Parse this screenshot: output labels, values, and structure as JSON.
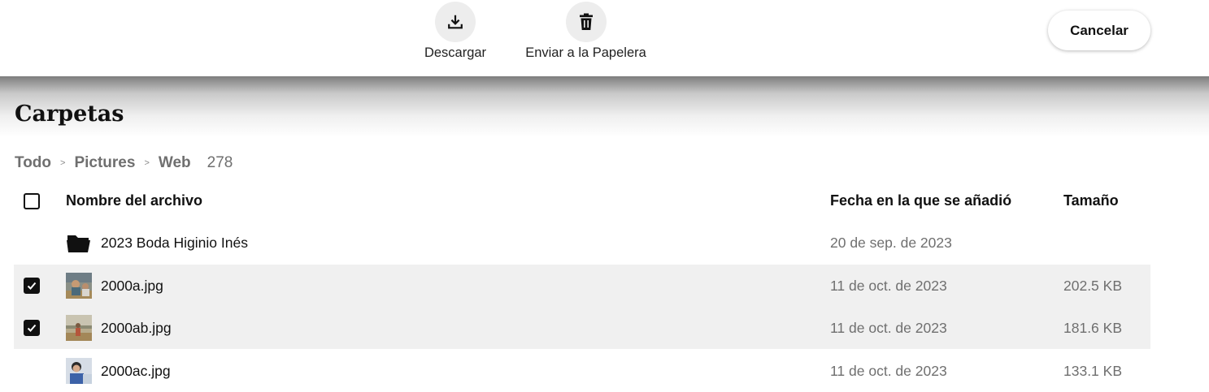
{
  "toolbar": {
    "actions": [
      {
        "label": "Descargar",
        "icon": "download-icon"
      },
      {
        "label": "Enviar a la Papelera",
        "icon": "trash-icon"
      }
    ],
    "cancel_label": "Cancelar"
  },
  "page": {
    "title": "Carpetas",
    "breadcrumb": [
      "Todo",
      "Pictures",
      "Web"
    ],
    "item_count": "278"
  },
  "table": {
    "columns": {
      "name": "Nombre del archivo",
      "date": "Fecha en la que se añadió",
      "size": "Tamaño"
    },
    "rows": [
      {
        "type": "folder",
        "name": "2023 Boda Higinio Inés",
        "date": "20 de sep. de 2023",
        "size": "",
        "selected": false
      },
      {
        "type": "image",
        "name": "2000a.jpg",
        "date": "11 de oct. de 2023",
        "size": "202.5 KB",
        "selected": true
      },
      {
        "type": "image",
        "name": "2000ab.jpg",
        "date": "11 de oct. de 2023",
        "size": "181.6 KB",
        "selected": true
      },
      {
        "type": "image",
        "name": "2000ac.jpg",
        "date": "11 de oct. de 2023",
        "size": "133.1 KB",
        "selected": false
      }
    ]
  },
  "colors": {
    "selected_row_bg": "#f0f0f0",
    "secondary_text": "#6f6f6f",
    "icon_circle_bg": "#ededed"
  }
}
